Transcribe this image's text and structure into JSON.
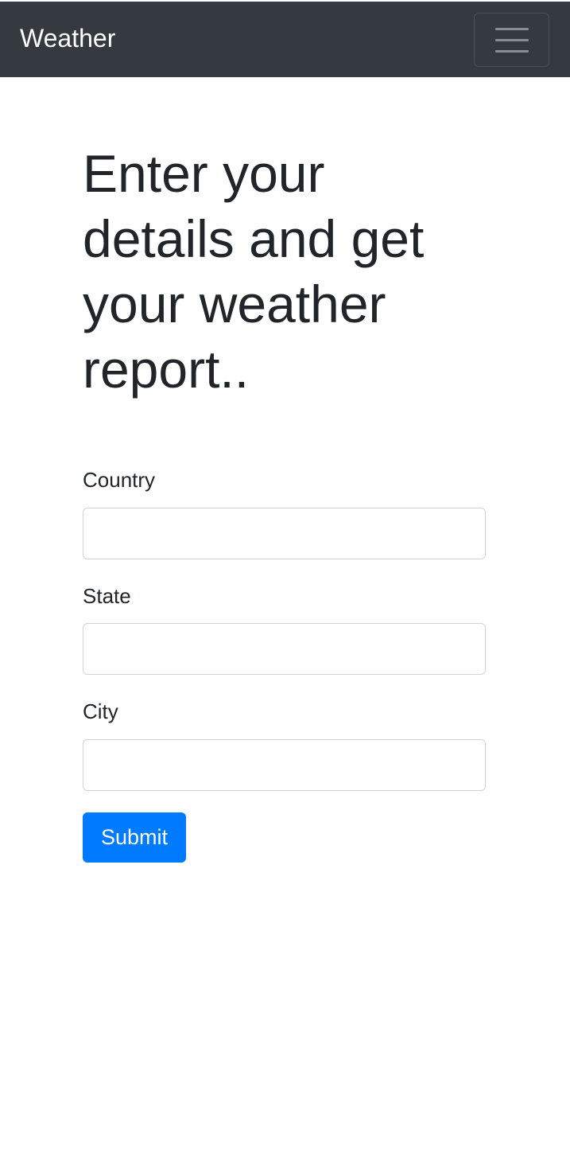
{
  "navbar": {
    "brand": "Weather",
    "menu_icon": "hamburger-menu-icon"
  },
  "main": {
    "heading": "Enter your details and get your weather report..",
    "form": {
      "country_label": "Country",
      "country_value": "",
      "state_label": "State",
      "state_value": "",
      "city_label": "City",
      "city_value": "",
      "submit_label": "Submit"
    }
  },
  "colors": {
    "navbar_bg": "#343a40",
    "primary": "#007bff",
    "text": "#212529",
    "input_border": "#ced4da"
  }
}
